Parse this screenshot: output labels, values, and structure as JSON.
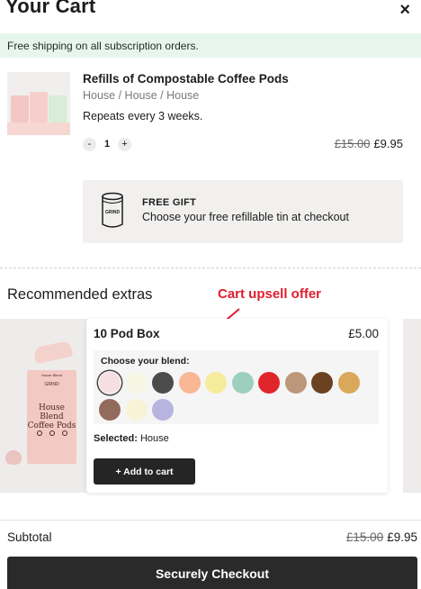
{
  "header": {
    "title": "Your Cart",
    "close_label": "×"
  },
  "banner": {
    "text": "Free shipping on all subscription orders."
  },
  "cart_item": {
    "name": "Refills of Compostable Coffee Pods",
    "variant": "House / House / House",
    "repeat": "Repeats every 3 weeks.",
    "quantity": "1",
    "decrement_label": "-",
    "increment_label": "+",
    "original_price": "£15.00",
    "price": "£9.95"
  },
  "gift": {
    "title": "FREE GIFT",
    "text": "Choose your free refillable tin at checkout",
    "icon_label": "GRIND"
  },
  "recommended": {
    "title": "Recommended extras",
    "annotation": "Cart upsell offer",
    "product": {
      "name": "10 Pod Box",
      "price": "£5.00",
      "blend_label": "Choose your blend:",
      "selected_label": "Selected:",
      "selected_value": "House",
      "add_label": "+ Add to cart",
      "box_top": "House Blend",
      "box_brand": "GRIND",
      "box_line1": "House Blend",
      "box_line2": "Coffee Pods"
    },
    "swatches": [
      "#f6dfe3",
      "#f7f5e4",
      "#4b4b4b",
      "#f8b795",
      "#f6ec9c",
      "#9ccfbd",
      "#e0262b",
      "#bd977a",
      "#6a4222",
      "#d9a85a",
      "#926b5c",
      "#f8f3d6",
      "#b8b4df"
    ],
    "selected_swatch_index": 0
  },
  "summary": {
    "subtotal_label": "Subtotal",
    "original_price": "£15.00",
    "price": "£9.95"
  },
  "checkout": {
    "label": "Securely Checkout"
  }
}
